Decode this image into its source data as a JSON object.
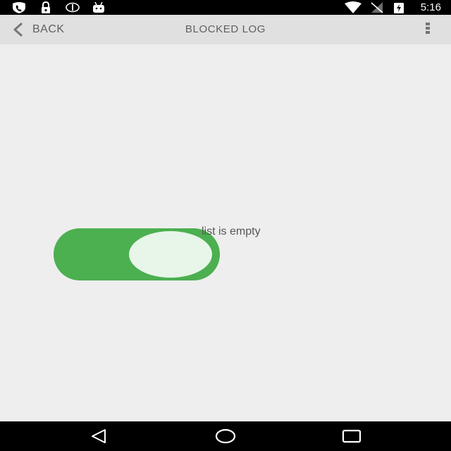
{
  "status_bar": {
    "time": "5:16",
    "icons": [
      "phone-shield-icon",
      "lock-icon",
      "eye-icon",
      "android-icon",
      "wifi-icon",
      "no-signal-icon",
      "battery-charging-icon"
    ]
  },
  "toolbar": {
    "back_label": "BACK",
    "title": "BLOCKED LOG"
  },
  "main": {
    "toggle": {
      "state": "on",
      "accent_color": "#4caf50"
    },
    "empty_message": "list is empty"
  },
  "nav_bar": {
    "buttons": [
      "back-triangle-icon",
      "home-circle-icon",
      "recents-square-icon"
    ]
  }
}
